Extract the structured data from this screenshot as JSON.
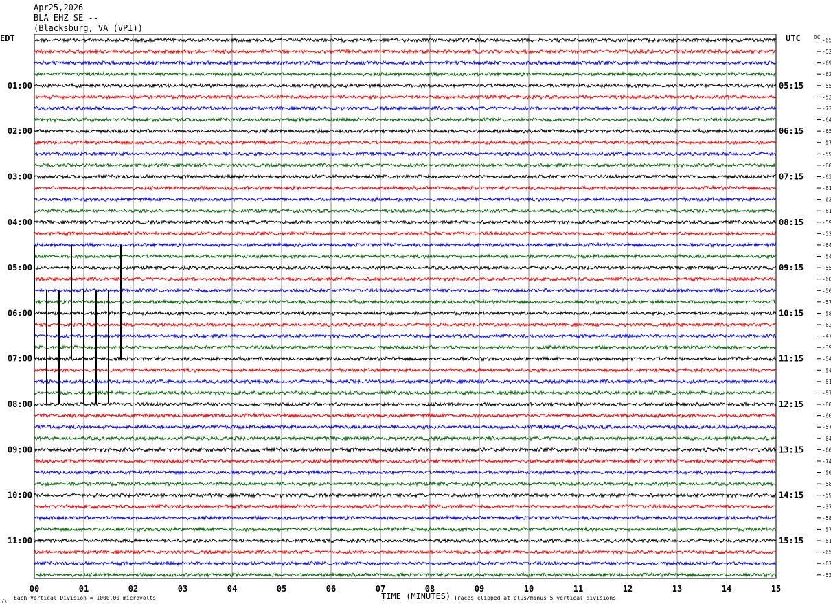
{
  "header": {
    "date": "Apr25,2026",
    "station": "BLA EHZ SE --",
    "location": "(Blacksburg, VA (VPI))"
  },
  "left_tz": "EDT",
  "right_tz": "UTC",
  "dc_label": "DC",
  "footer": {
    "scale_note": "Each Vertical Division = 1000.00 microvolts",
    "clip_note": "Traces clipped at plus/minus 5 vertical divisions",
    "corner_mark": "/\\"
  },
  "chart_data": {
    "type": "line",
    "title": "",
    "xlabel": "TIME (MINUTES)",
    "ylabel": "",
    "x_ticks": [
      "00",
      "01",
      "02",
      "03",
      "04",
      "05",
      "06",
      "07",
      "08",
      "09",
      "10",
      "11",
      "12",
      "13",
      "14",
      "15"
    ],
    "xlim": [
      0,
      15
    ],
    "grid": true,
    "line_colors": [
      "#000000",
      "#ff0000",
      "#0000ff",
      "#006600"
    ],
    "left_hour_labels": [
      "01:00",
      "02:00",
      "03:00",
      "04:00",
      "05:00",
      "06:00",
      "07:00",
      "08:00",
      "09:00",
      "10:00",
      "11:00"
    ],
    "right_hour_labels": [
      "05:15",
      "06:15",
      "07:15",
      "08:15",
      "09:15",
      "10:15",
      "11:15",
      "12:15",
      "13:15",
      "14:15",
      "15:15"
    ],
    "first_labeled_row": 4,
    "dc_offsets": [
      -65,
      -52,
      -69,
      -62,
      -55,
      -52,
      -72,
      -64,
      -65,
      -57,
      -59,
      -60,
      -62,
      -61,
      -63,
      -61,
      -59,
      -53,
      -64,
      -54,
      -55,
      -60,
      -56,
      -57,
      -58,
      -62,
      -47,
      -39,
      -54,
      -54,
      -61,
      -57,
      -60,
      -60,
      -57,
      -64,
      -66,
      -74,
      -56,
      -58,
      -59,
      -37,
      -58,
      -57,
      -61,
      -65,
      -67,
      -53
    ],
    "spikes": [
      {
        "row": 23,
        "minute": 0.0
      },
      {
        "row": 23,
        "minute": 0.75
      },
      {
        "row": 23,
        "minute": 1.75
      },
      {
        "row": 27,
        "minute": 0.25
      },
      {
        "row": 27,
        "minute": 0.5
      },
      {
        "row": 27,
        "minute": 1.0
      },
      {
        "row": 27,
        "minute": 1.25
      },
      {
        "row": 27,
        "minute": 1.5
      }
    ]
  }
}
